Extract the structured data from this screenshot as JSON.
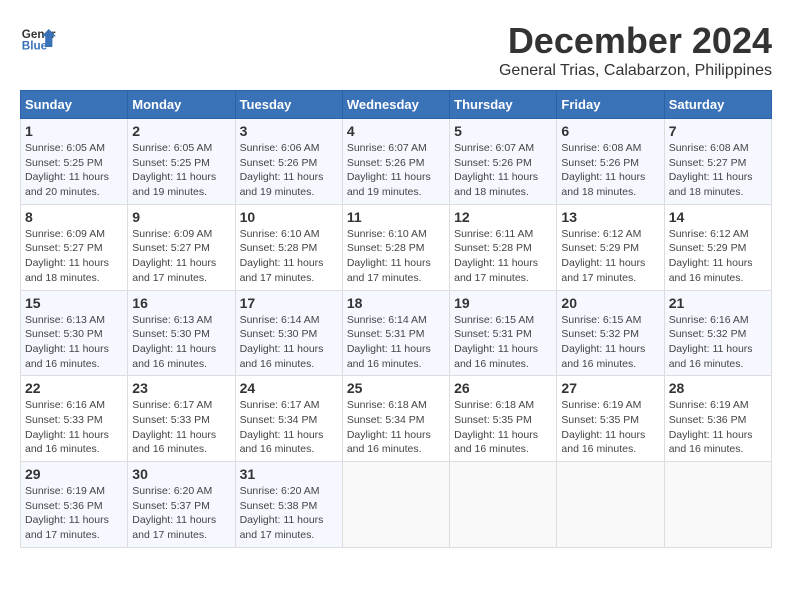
{
  "header": {
    "logo_line1": "General",
    "logo_line2": "Blue",
    "month_title": "December 2024",
    "location": "General Trias, Calabarzon, Philippines"
  },
  "columns": [
    "Sunday",
    "Monday",
    "Tuesday",
    "Wednesday",
    "Thursday",
    "Friday",
    "Saturday"
  ],
  "weeks": [
    [
      {
        "day": "1",
        "sunrise": "6:05 AM",
        "sunset": "5:25 PM",
        "daylight": "11 hours and 20 minutes."
      },
      {
        "day": "2",
        "sunrise": "6:05 AM",
        "sunset": "5:25 PM",
        "daylight": "11 hours and 19 minutes."
      },
      {
        "day": "3",
        "sunrise": "6:06 AM",
        "sunset": "5:26 PM",
        "daylight": "11 hours and 19 minutes."
      },
      {
        "day": "4",
        "sunrise": "6:07 AM",
        "sunset": "5:26 PM",
        "daylight": "11 hours and 19 minutes."
      },
      {
        "day": "5",
        "sunrise": "6:07 AM",
        "sunset": "5:26 PM",
        "daylight": "11 hours and 18 minutes."
      },
      {
        "day": "6",
        "sunrise": "6:08 AM",
        "sunset": "5:26 PM",
        "daylight": "11 hours and 18 minutes."
      },
      {
        "day": "7",
        "sunrise": "6:08 AM",
        "sunset": "5:27 PM",
        "daylight": "11 hours and 18 minutes."
      }
    ],
    [
      {
        "day": "8",
        "sunrise": "6:09 AM",
        "sunset": "5:27 PM",
        "daylight": "11 hours and 18 minutes."
      },
      {
        "day": "9",
        "sunrise": "6:09 AM",
        "sunset": "5:27 PM",
        "daylight": "11 hours and 17 minutes."
      },
      {
        "day": "10",
        "sunrise": "6:10 AM",
        "sunset": "5:28 PM",
        "daylight": "11 hours and 17 minutes."
      },
      {
        "day": "11",
        "sunrise": "6:10 AM",
        "sunset": "5:28 PM",
        "daylight": "11 hours and 17 minutes."
      },
      {
        "day": "12",
        "sunrise": "6:11 AM",
        "sunset": "5:28 PM",
        "daylight": "11 hours and 17 minutes."
      },
      {
        "day": "13",
        "sunrise": "6:12 AM",
        "sunset": "5:29 PM",
        "daylight": "11 hours and 17 minutes."
      },
      {
        "day": "14",
        "sunrise": "6:12 AM",
        "sunset": "5:29 PM",
        "daylight": "11 hours and 16 minutes."
      }
    ],
    [
      {
        "day": "15",
        "sunrise": "6:13 AM",
        "sunset": "5:30 PM",
        "daylight": "11 hours and 16 minutes."
      },
      {
        "day": "16",
        "sunrise": "6:13 AM",
        "sunset": "5:30 PM",
        "daylight": "11 hours and 16 minutes."
      },
      {
        "day": "17",
        "sunrise": "6:14 AM",
        "sunset": "5:30 PM",
        "daylight": "11 hours and 16 minutes."
      },
      {
        "day": "18",
        "sunrise": "6:14 AM",
        "sunset": "5:31 PM",
        "daylight": "11 hours and 16 minutes."
      },
      {
        "day": "19",
        "sunrise": "6:15 AM",
        "sunset": "5:31 PM",
        "daylight": "11 hours and 16 minutes."
      },
      {
        "day": "20",
        "sunrise": "6:15 AM",
        "sunset": "5:32 PM",
        "daylight": "11 hours and 16 minutes."
      },
      {
        "day": "21",
        "sunrise": "6:16 AM",
        "sunset": "5:32 PM",
        "daylight": "11 hours and 16 minutes."
      }
    ],
    [
      {
        "day": "22",
        "sunrise": "6:16 AM",
        "sunset": "5:33 PM",
        "daylight": "11 hours and 16 minutes."
      },
      {
        "day": "23",
        "sunrise": "6:17 AM",
        "sunset": "5:33 PM",
        "daylight": "11 hours and 16 minutes."
      },
      {
        "day": "24",
        "sunrise": "6:17 AM",
        "sunset": "5:34 PM",
        "daylight": "11 hours and 16 minutes."
      },
      {
        "day": "25",
        "sunrise": "6:18 AM",
        "sunset": "5:34 PM",
        "daylight": "11 hours and 16 minutes."
      },
      {
        "day": "26",
        "sunrise": "6:18 AM",
        "sunset": "5:35 PM",
        "daylight": "11 hours and 16 minutes."
      },
      {
        "day": "27",
        "sunrise": "6:19 AM",
        "sunset": "5:35 PM",
        "daylight": "11 hours and 16 minutes."
      },
      {
        "day": "28",
        "sunrise": "6:19 AM",
        "sunset": "5:36 PM",
        "daylight": "11 hours and 16 minutes."
      }
    ],
    [
      {
        "day": "29",
        "sunrise": "6:19 AM",
        "sunset": "5:36 PM",
        "daylight": "11 hours and 17 minutes."
      },
      {
        "day": "30",
        "sunrise": "6:20 AM",
        "sunset": "5:37 PM",
        "daylight": "11 hours and 17 minutes."
      },
      {
        "day": "31",
        "sunrise": "6:20 AM",
        "sunset": "5:38 PM",
        "daylight": "11 hours and 17 minutes."
      },
      null,
      null,
      null,
      null
    ]
  ]
}
